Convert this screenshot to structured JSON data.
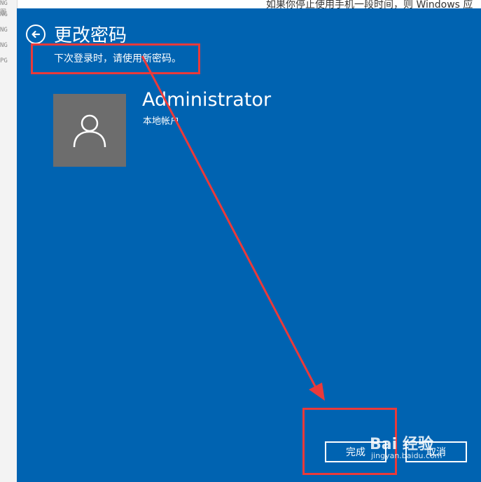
{
  "background": {
    "top_text": "如果你停止使用手机一段时间，则 Windows 应",
    "bottom_text": "",
    "left_fragments": [
      "NG 图",
      "NG",
      "NG",
      "NG",
      "PG"
    ]
  },
  "dialog": {
    "title": "更改密码",
    "subtitle": "下次登录时，请使用新密码。",
    "account": {
      "name": "Administrator",
      "type": "本地帐户"
    },
    "buttons": {
      "finish": "完成",
      "cancel": "取消"
    }
  },
  "watermark": {
    "logo": "Bai 经验",
    "url": "jingyan.baidu.com"
  },
  "colors": {
    "dialog_bg": "#0063b1",
    "avatar_bg": "#6d6d6d",
    "annotation": "#ea3a3a"
  },
  "icons": {
    "back": "back-arrow-icon",
    "avatar": "user-icon"
  }
}
